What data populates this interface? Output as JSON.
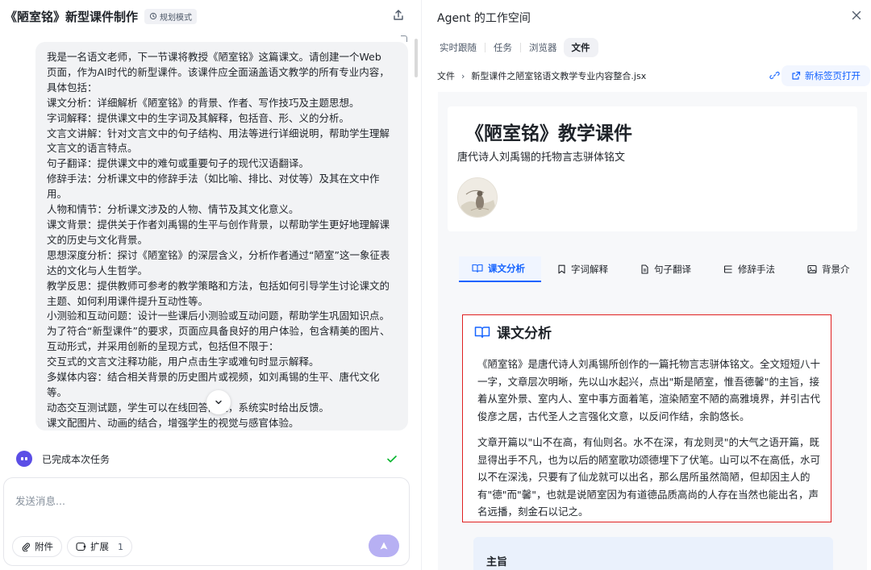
{
  "chat": {
    "title": "《陋室铭》新型课件制作",
    "mode_badge": "规划模式",
    "message_lines": [
      "我是一名语文老师，下一节课将教授《陋室铭》这篇课文。请创建一个Web",
      "页面，作为AI时代的新型课件。该课件应全面涵盖语文教学的所有专业内容，",
      "具体包括：",
      "课文分析：详细解析《陋室铭》的背景、作者、写作技巧及主题思想。",
      "字词解释：提供课文中的生字词及其解释，包括音、形、义的分析。",
      "文言文讲解：针对文言文中的句子结构、用法等进行详细说明，帮助学生理解",
      "文言文的语言特点。",
      "句子翻译：提供课文中的难句或重要句子的现代汉语翻译。",
      "修辞手法：分析课文中的修辞手法（如比喻、排比、对仗等）及其在文中作",
      "用。",
      "人物和情节：分析课文涉及的人物、情节及其文化意义。",
      "课文背景：提供关于作者刘禹锡的生平与创作背景，以帮助学生更好地理解课",
      "文的历史与文化背景。",
      "思想深度分析：探讨《陋室铭》的深层含义，分析作者通过“陋室”这一象征表",
      "达的文化与人生哲学。",
      "教学反思：提供教师可参考的教学策略和方法，包括如何引导学生讨论课文的",
      "主题、如何利用课件提升互动性等。",
      "小测验和互动问题：设计一些课后小测验或互动问题，帮助学生巩固知识点。",
      "为了符合“新型课件”的要求，页面应具备良好的用户体验，包含精美的图片、",
      "互动形式，并采用创新的呈现方式，包括但不限于：",
      "交互式的文言文注释功能，用户点击生字或难句时显示解释。",
      "多媒体内容：结合相关背景的历史图片或视频，如刘禹锡的生平、唐代文化",
      "等。",
      "动态交互测试题，学生可以在线回答问题，系统实时给出反馈。",
      "课文配图片、动画的结合，增强学生的视觉与感官体验。"
    ],
    "task_status": "已完成本次任务",
    "input_placeholder": "发送消息...",
    "attach_label": "附件",
    "extend_label": "扩展",
    "extend_count": "1"
  },
  "workspace": {
    "title": "Agent 的工作空间",
    "tabs": [
      "实时跟随",
      "任务",
      "浏览器",
      "文件"
    ],
    "active_tab": "文件",
    "breadcrumb_root": "文件",
    "breadcrumb_file": "新型课件之陋室铭语文教学专业内容整合.jsx",
    "open_new_tab": "新标签页打开"
  },
  "courseware": {
    "title": "《陋室铭》教学课件",
    "subtitle": "唐代诗人刘禹锡的托物言志骈体铭文",
    "tabs": [
      {
        "label": "课文分析",
        "icon": "book-icon",
        "active": true
      },
      {
        "label": "字词解释",
        "icon": "bookmark-icon",
        "active": false
      },
      {
        "label": "句子翻译",
        "icon": "document-icon",
        "active": false
      },
      {
        "label": "修辞手法",
        "icon": "list-icon",
        "active": false
      },
      {
        "label": "背景介",
        "icon": "image-icon",
        "active": false
      }
    ],
    "section_title": "课文分析",
    "paragraphs": [
      "《陋室铭》是唐代诗人刘禹锡所创作的一篇托物言志骈体铭文。全文短短八十一字，文章层次明晰，先以山水起兴，点出\"斯是陋室，惟吾德馨\"的主旨，接着从室外景、室内人、室中事方面着笔，渲染陋室不陋的高雅境界，并引古代俊彦之居，古代圣人之言强化文意，以反问作结，余韵悠长。",
      "文章开篇以\"山不在高，有仙则名。水不在深，有龙则灵\"的大气之语开篇，既显得出手不凡，也为以后的陋室歌功颂德埋下了伏笔。山可以不在高低，水可以不在深浅，只要有了仙龙就可以出名，那么居所虽然简陋，但却因主人的有\"德\"而\"馨\"，也就是说陋室因为有道德品质高尚的人存在当然也能出名，声名远播，刻金石以记之。"
    ],
    "theme_title": "主旨"
  },
  "colors": {
    "accent_blue": "#1664ff",
    "highlight_red": "#e02020",
    "send_purple": "#b7b0f3",
    "bot_purple": "#5b4ee6",
    "success_green": "#00b42a"
  }
}
